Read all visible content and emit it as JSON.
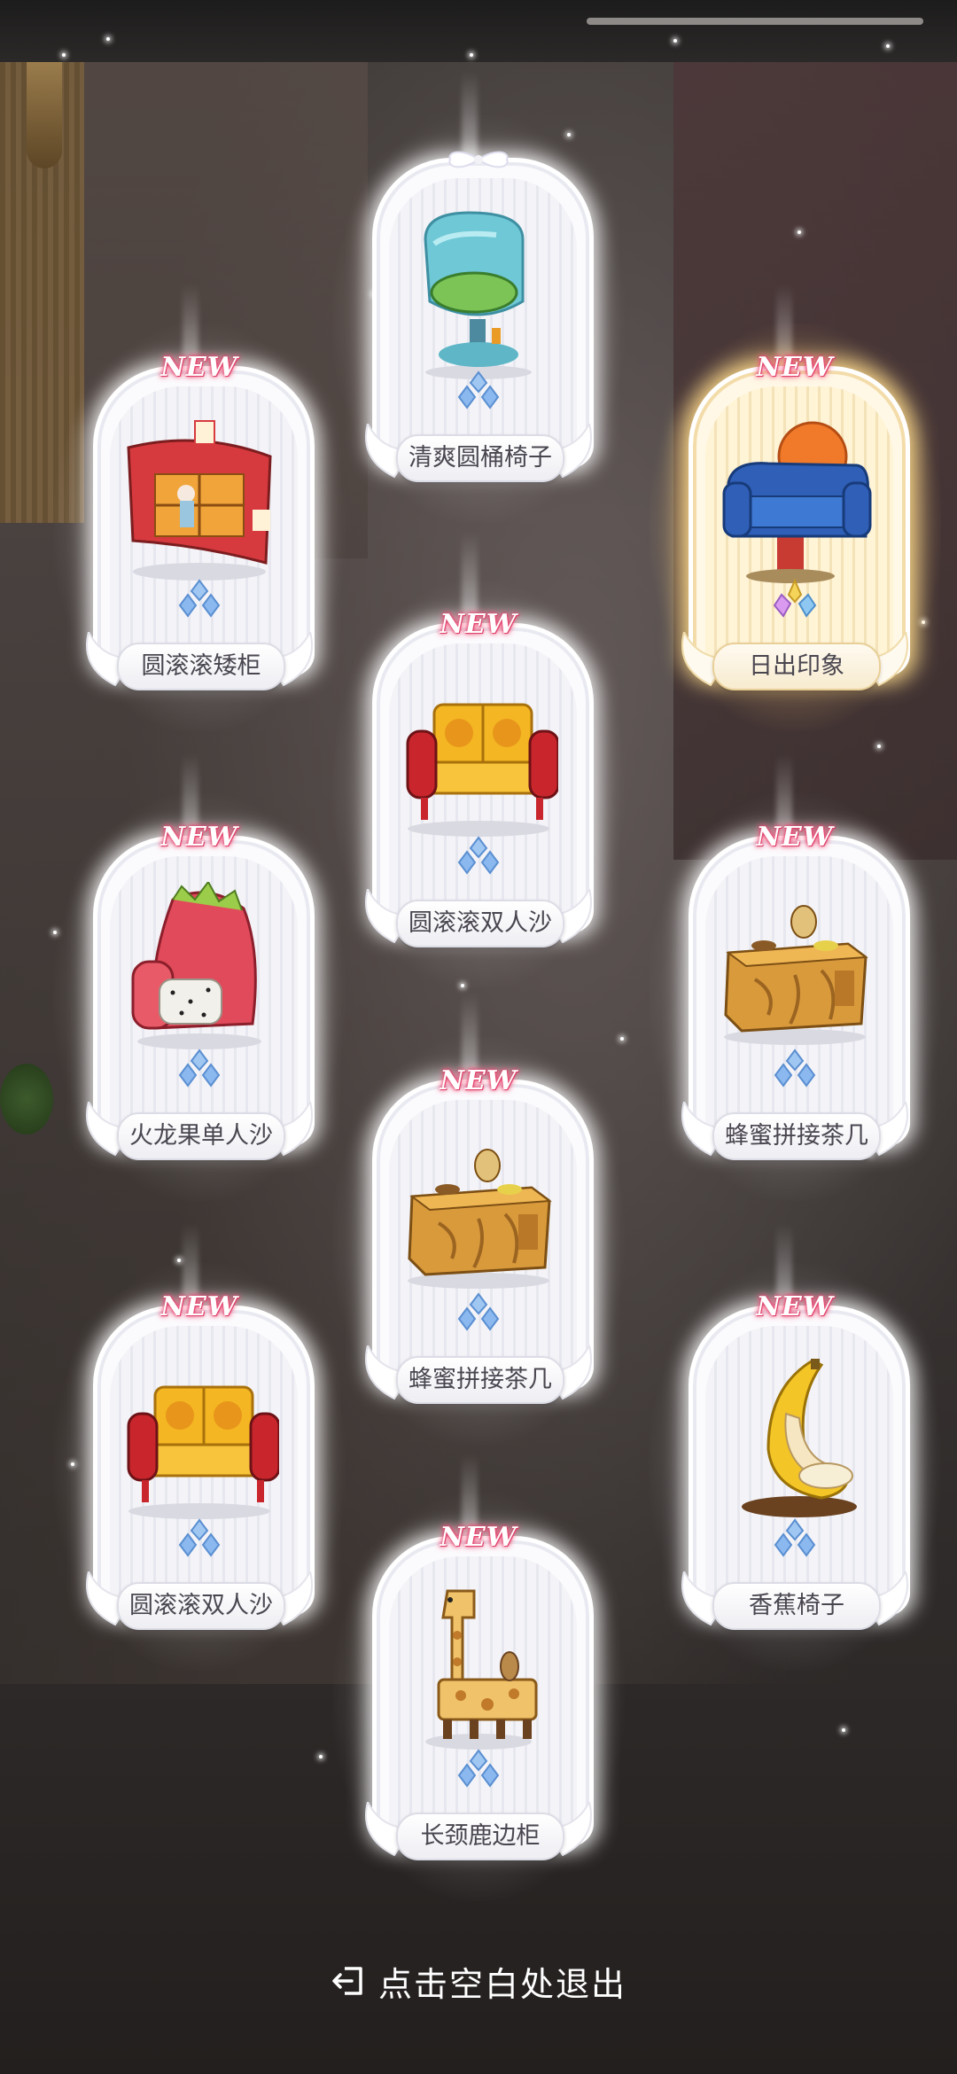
{
  "badge_text": "NEW",
  "cards": [
    {
      "name": "清爽圆桶椅子",
      "is_new": false,
      "rarity": "normal",
      "icon": "round-chair-icon"
    },
    {
      "name": "圆滚滚矮柜",
      "is_new": true,
      "rarity": "normal",
      "icon": "low-cabinet-icon"
    },
    {
      "name": "日出印象",
      "is_new": true,
      "rarity": "gold",
      "icon": "sunrise-armchair-icon"
    },
    {
      "name": "圆滚滚双人沙",
      "is_new": true,
      "rarity": "normal",
      "icon": "loveseat-icon"
    },
    {
      "name": "火龙果单人沙",
      "is_new": true,
      "rarity": "normal",
      "icon": "dragonfruit-chair-icon"
    },
    {
      "name": "蜂蜜拼接茶几",
      "is_new": true,
      "rarity": "normal",
      "icon": "honey-tea-table-icon"
    },
    {
      "name": "蜂蜜拼接茶几",
      "is_new": true,
      "rarity": "normal",
      "icon": "honey-tea-table-icon"
    },
    {
      "name": "圆滚滚双人沙",
      "is_new": true,
      "rarity": "normal",
      "icon": "loveseat-icon"
    },
    {
      "name": "香蕉椅子",
      "is_new": true,
      "rarity": "normal",
      "icon": "banana-chair-icon"
    },
    {
      "name": "长颈鹿边柜",
      "is_new": true,
      "rarity": "normal",
      "icon": "giraffe-cabinet-icon"
    }
  ],
  "exit_hint": {
    "label": "点击空白处退出",
    "icon": "exit-icon"
  },
  "colors": {
    "badge_pink": "#e2416c",
    "gold_glow": "#ffdc8c",
    "gem_blue": "#7fb3ea"
  }
}
